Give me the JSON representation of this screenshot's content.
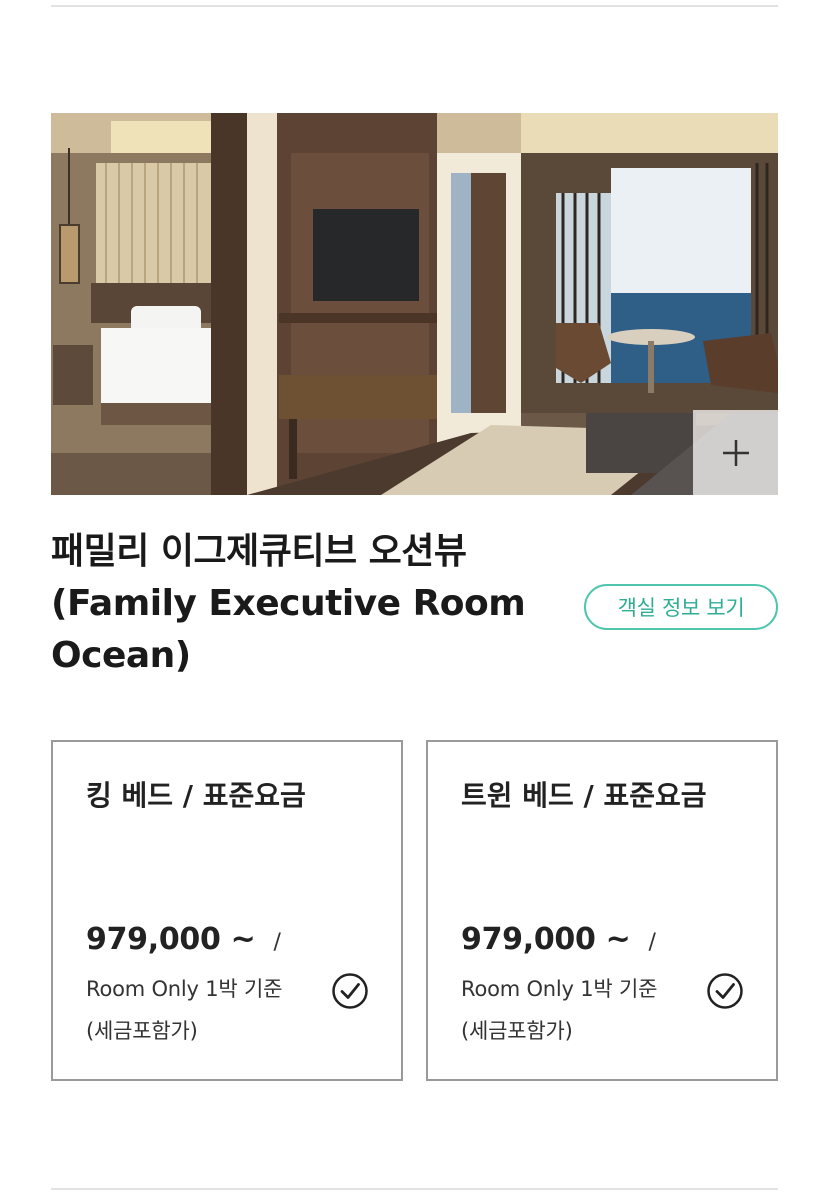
{
  "room": {
    "title": "패밀리 이그제큐티브 오션뷰(Family Executive Room Ocean)",
    "info_button_label": "객실 정보 보기",
    "photo_icon": "plus-icon"
  },
  "rates": [
    {
      "name": "킹 베드 / 표준요금",
      "price": "979,000 ~",
      "slash": "/",
      "basis": "Room Only 1박 기준 (세금포함가)",
      "check_icon": "check-circle-icon"
    },
    {
      "name": "트윈 베드 / 표준요금",
      "price": "979,000 ~",
      "slash": "/",
      "basis": "Room Only 1박 기준 (세금포함가)",
      "check_icon": "check-circle-icon"
    }
  ],
  "colors": {
    "accent": "#4fc5ad",
    "card_border": "#9a9a9a",
    "divider": "#e2e2e2"
  }
}
